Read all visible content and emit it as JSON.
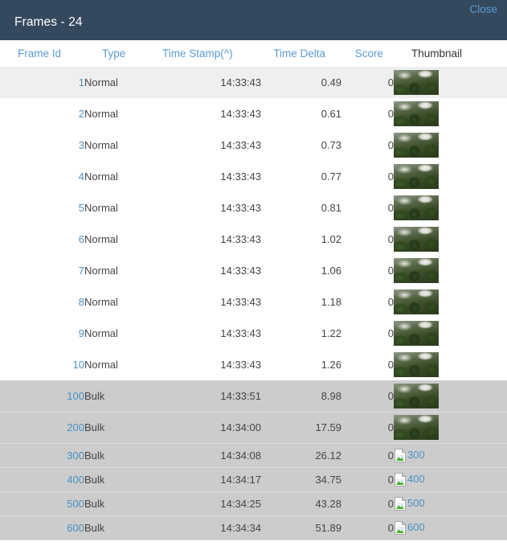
{
  "modal": {
    "title": "Frames - 24",
    "close_label": "Close",
    "header_bg": "#34495e",
    "link_color": "#5b9bd5"
  },
  "table": {
    "columns": [
      {
        "key": "frame_id",
        "label": "Frame Id",
        "sortable": true
      },
      {
        "key": "type",
        "label": "Type",
        "sortable": true
      },
      {
        "key": "time_stamp",
        "label": "Time Stamp(^)",
        "sortable": true
      },
      {
        "key": "time_delta",
        "label": "Time Delta",
        "sortable": true
      },
      {
        "key": "score",
        "label": "Score",
        "sortable": true
      },
      {
        "key": "thumbnail",
        "label": "Thumbnail",
        "sortable": false
      }
    ],
    "rows": [
      {
        "frame_id": "1",
        "type": "Normal",
        "time_stamp": "14:33:43",
        "time_delta": "0.49",
        "score": "0",
        "thumb_state": "image",
        "thumb_alt": "1",
        "row_style": "striped",
        "row_height": "tall"
      },
      {
        "frame_id": "2",
        "type": "Normal",
        "time_stamp": "14:33:43",
        "time_delta": "0.61",
        "score": "0",
        "thumb_state": "image",
        "thumb_alt": "2",
        "row_style": "plain",
        "row_height": "tall"
      },
      {
        "frame_id": "3",
        "type": "Normal",
        "time_stamp": "14:33:43",
        "time_delta": "0.73",
        "score": "0",
        "thumb_state": "image",
        "thumb_alt": "3",
        "row_style": "plain",
        "row_height": "tall"
      },
      {
        "frame_id": "4",
        "type": "Normal",
        "time_stamp": "14:33:43",
        "time_delta": "0.77",
        "score": "0",
        "thumb_state": "image",
        "thumb_alt": "4",
        "row_style": "plain",
        "row_height": "tall"
      },
      {
        "frame_id": "5",
        "type": "Normal",
        "time_stamp": "14:33:43",
        "time_delta": "0.81",
        "score": "0",
        "thumb_state": "image",
        "thumb_alt": "5",
        "row_style": "plain",
        "row_height": "tall"
      },
      {
        "frame_id": "6",
        "type": "Normal",
        "time_stamp": "14:33:43",
        "time_delta": "1.02",
        "score": "0",
        "thumb_state": "image",
        "thumb_alt": "6",
        "row_style": "plain",
        "row_height": "tall"
      },
      {
        "frame_id": "7",
        "type": "Normal",
        "time_stamp": "14:33:43",
        "time_delta": "1.06",
        "score": "0",
        "thumb_state": "image",
        "thumb_alt": "7",
        "row_style": "plain",
        "row_height": "tall"
      },
      {
        "frame_id": "8",
        "type": "Normal",
        "time_stamp": "14:33:43",
        "time_delta": "1.18",
        "score": "0",
        "thumb_state": "image",
        "thumb_alt": "8",
        "row_style": "plain",
        "row_height": "tall"
      },
      {
        "frame_id": "9",
        "type": "Normal",
        "time_stamp": "14:33:43",
        "time_delta": "1.22",
        "score": "0",
        "thumb_state": "image",
        "thumb_alt": "9",
        "row_style": "plain",
        "row_height": "tall"
      },
      {
        "frame_id": "10",
        "type": "Normal",
        "time_stamp": "14:33:43",
        "time_delta": "1.26",
        "score": "0",
        "thumb_state": "image",
        "thumb_alt": "10",
        "row_style": "plain",
        "row_height": "tall"
      },
      {
        "frame_id": "100",
        "type": "Bulk",
        "time_stamp": "14:33:51",
        "time_delta": "8.98",
        "score": "0",
        "thumb_state": "image",
        "thumb_alt": "100",
        "row_style": "selected",
        "row_height": "tall"
      },
      {
        "frame_id": "200",
        "type": "Bulk",
        "time_stamp": "14:34:00",
        "time_delta": "17.59",
        "score": "0",
        "thumb_state": "image",
        "thumb_alt": "200",
        "row_style": "selected",
        "row_height": "tall"
      },
      {
        "frame_id": "300",
        "type": "Bulk",
        "time_stamp": "14:34:08",
        "time_delta": "26.12",
        "score": "0",
        "thumb_state": "broken",
        "thumb_alt": "300",
        "row_style": "selected",
        "row_height": "short"
      },
      {
        "frame_id": "400",
        "type": "Bulk",
        "time_stamp": "14:34:17",
        "time_delta": "34.75",
        "score": "0",
        "thumb_state": "broken",
        "thumb_alt": "400",
        "row_style": "selected",
        "row_height": "short"
      },
      {
        "frame_id": "500",
        "type": "Bulk",
        "time_stamp": "14:34:25",
        "time_delta": "43.28",
        "score": "0",
        "thumb_state": "broken",
        "thumb_alt": "500",
        "row_style": "selected",
        "row_height": "short"
      },
      {
        "frame_id": "600",
        "type": "Bulk",
        "time_stamp": "14:34:34",
        "time_delta": "51.89",
        "score": "0",
        "thumb_state": "broken",
        "thumb_alt": "600",
        "row_style": "selected",
        "row_height": "short"
      }
    ]
  }
}
